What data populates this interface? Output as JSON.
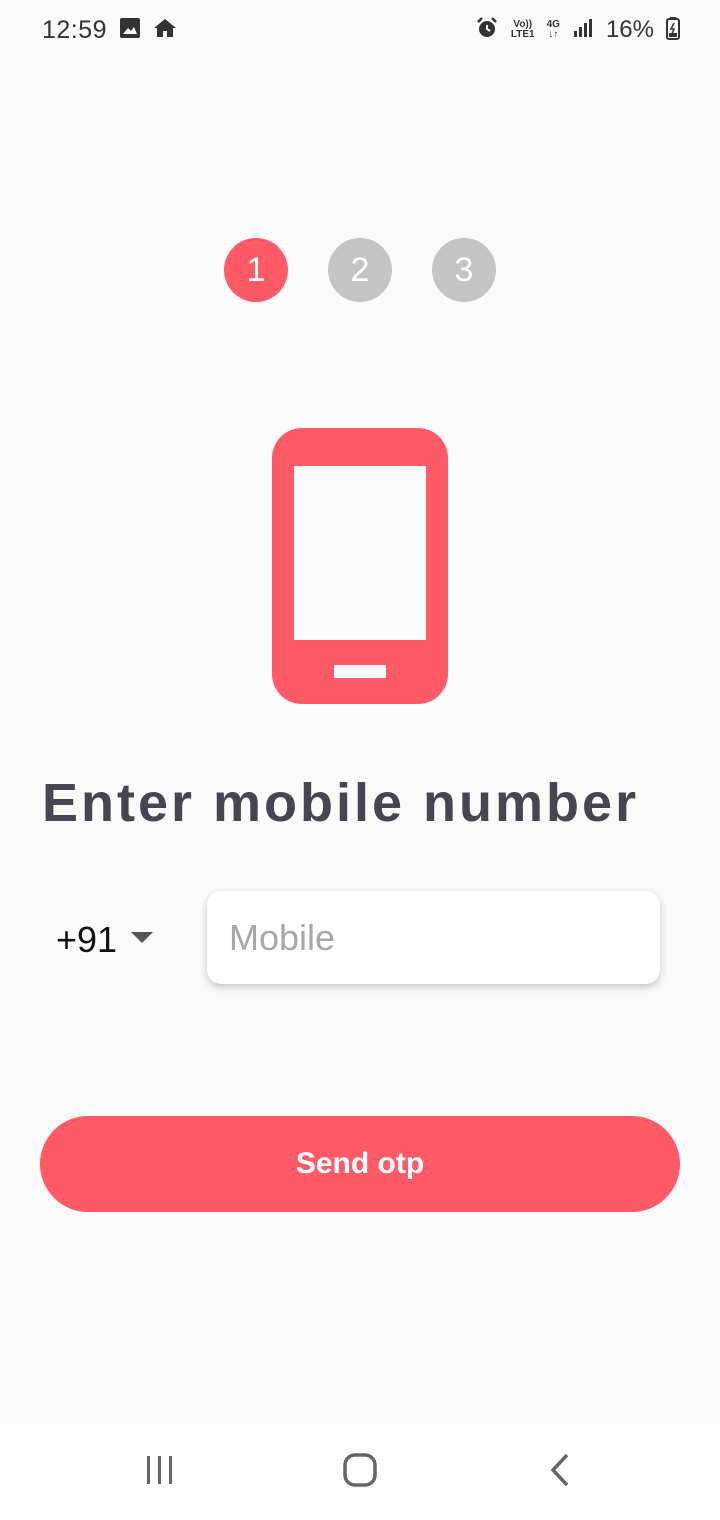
{
  "status_bar": {
    "time": "12:59",
    "volte_top": "Vo))",
    "volte_bottom": "LTE1",
    "net_type": "4G",
    "battery": "16%",
    "icons": [
      "image-icon",
      "home-icon",
      "alarm-icon",
      "volte-icon",
      "network-4g-icon",
      "signal-icon",
      "battery-icon"
    ]
  },
  "stepper": {
    "steps": [
      {
        "label": "1",
        "active": true
      },
      {
        "label": "2",
        "active": false
      },
      {
        "label": "3",
        "active": false
      }
    ]
  },
  "illustration": "smartphone-icon",
  "heading": "Enter mobile number",
  "form": {
    "country_code": "+91",
    "mobile_placeholder": "Mobile",
    "mobile_value": ""
  },
  "button": {
    "label": "Send otp"
  },
  "nav_bar": {
    "icons": [
      "recent-apps-icon",
      "home-button-icon",
      "back-icon"
    ]
  },
  "colors": {
    "accent": "#ff5a67",
    "inactive_step": "#c4c4c4",
    "heading": "#474550",
    "background": "#fafafa"
  }
}
